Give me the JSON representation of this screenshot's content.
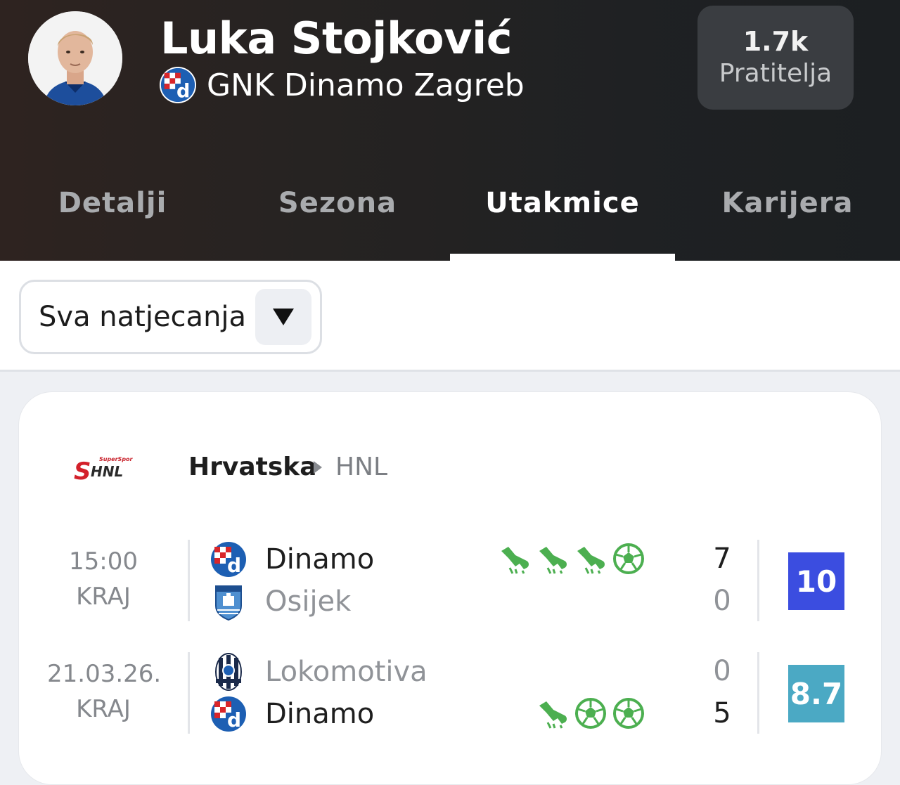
{
  "player": {
    "name": "Luka Stojković",
    "club": "GNK Dinamo Zagreb",
    "followers_count": "1.7k",
    "followers_label": "Pratitelja"
  },
  "tabs": [
    {
      "label": "Detalji",
      "active": false
    },
    {
      "label": "Sezona",
      "active": false
    },
    {
      "label": "Utakmice",
      "active": true
    },
    {
      "label": "Karijera",
      "active": false
    }
  ],
  "filter": {
    "selected": "Sva natjecanja"
  },
  "league": {
    "country": "Hrvatska",
    "name": "HNL",
    "logo_text": "SHNL",
    "logo_small": "SuperSport"
  },
  "matches": [
    {
      "time": "15:00",
      "status": "KRAJ",
      "home": {
        "name": "Dinamo",
        "score": "7",
        "result": "win"
      },
      "away": {
        "name": "Osijek",
        "score": "0",
        "result": "lose"
      },
      "home_events": [
        "boot-icon",
        "boot-icon",
        "boot-icon",
        "ball-icon"
      ],
      "away_events": [],
      "rating": "10",
      "rating_color": "#3b4de0"
    },
    {
      "time": "21.03.26.",
      "status": "KRAJ",
      "home": {
        "name": "Lokomotiva",
        "score": "0",
        "result": "lose"
      },
      "away": {
        "name": "Dinamo",
        "score": "5",
        "result": "win"
      },
      "home_events": [],
      "away_events": [
        "boot-icon",
        "ball-icon",
        "ball-icon"
      ],
      "rating": "8.7",
      "rating_color": "#4ba9c4"
    }
  ],
  "colors": {
    "event_green": "#4caf50",
    "header_bg": "#262322",
    "dinamo_blue": "#1d5fb3"
  }
}
